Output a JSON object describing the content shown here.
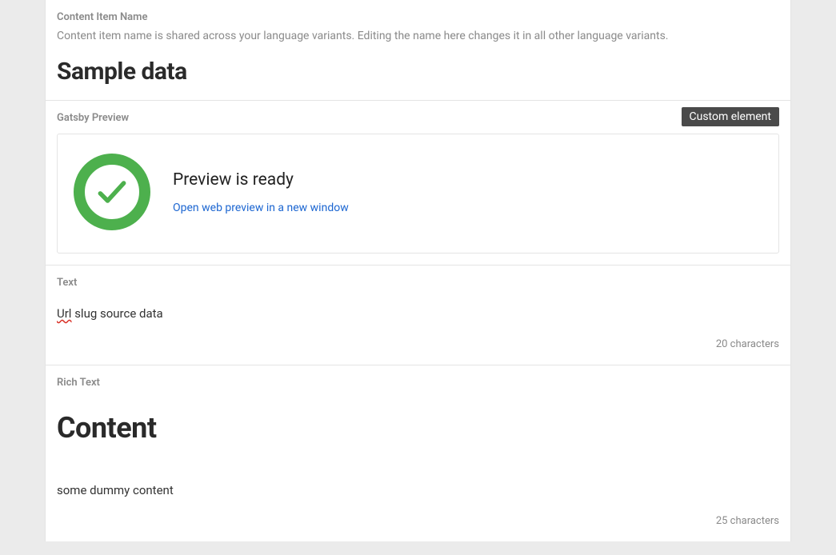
{
  "nameSection": {
    "label": "Content Item Name",
    "help": "Content item name is shared across your language variants. Editing the name here changes it in all other language variants.",
    "value": "Sample data"
  },
  "gatsbySection": {
    "label": "Gatsby Preview",
    "badge": "Custom element",
    "heading": "Preview is ready",
    "linkText": "Open web preview in a new window"
  },
  "textSection": {
    "label": "Text",
    "spellWord": "Url",
    "rest": " slug source data",
    "count": "20 characters"
  },
  "richSection": {
    "label": "Rich Text",
    "heading": "Content",
    "body": "some dummy content",
    "count": "25 characters"
  }
}
